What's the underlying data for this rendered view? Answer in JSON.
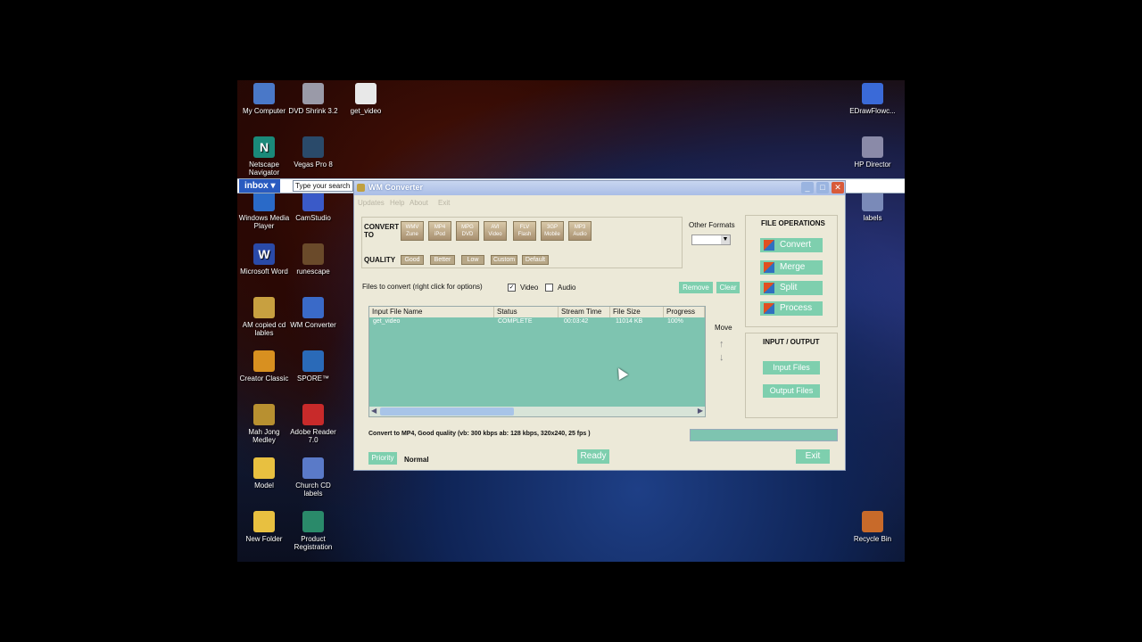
{
  "desktop": {
    "icons": [
      {
        "label": "My Computer",
        "icon": "computer-icon",
        "color": "#4a78c8"
      },
      {
        "label": "DVD Shrink 3.2",
        "icon": "dvd-icon",
        "color": "#9a9aa8"
      },
      {
        "label": "get_video",
        "icon": "file-icon",
        "color": "#e8e8e8"
      },
      {
        "label": "Netscape Navigator",
        "icon": "netscape-icon",
        "color": "#1a8a7a",
        "glyph": "N"
      },
      {
        "label": "Vegas Pro 8",
        "icon": "vegas-icon",
        "color": "#2a4a6a"
      },
      {
        "label": "Windows Media Player",
        "icon": "media-player-icon",
        "color": "#2a6ac8"
      },
      {
        "label": "CamStudio",
        "icon": "camstudio-icon",
        "color": "#3a5ac8"
      },
      {
        "label": "Microsoft Word",
        "icon": "word-icon",
        "color": "#2a4aa8",
        "glyph": "W"
      },
      {
        "label": "runescape",
        "icon": "sword-icon",
        "color": "#6a4a2a"
      },
      {
        "label": "AM copied cd lables",
        "icon": "document-icon",
        "color": "#c8a040"
      },
      {
        "label": "WM Converter",
        "icon": "converter-icon",
        "color": "#3a6ac8"
      },
      {
        "label": "Creator Classic",
        "icon": "creator-icon",
        "color": "#d89020"
      },
      {
        "label": "SPORE™",
        "icon": "spore-icon",
        "color": "#2a6ab8"
      },
      {
        "label": "Mah Jong Medley",
        "icon": "mahjong-icon",
        "color": "#b89030"
      },
      {
        "label": "Adobe Reader 7.0",
        "icon": "pdf-icon",
        "color": "#c82a2a"
      },
      {
        "label": "Model",
        "icon": "folder-icon",
        "color": "#e8c040"
      },
      {
        "label": "Church CD labels",
        "icon": "word-doc-icon",
        "color": "#5a7ac8"
      },
      {
        "label": "New Folder",
        "icon": "folder-icon",
        "color": "#e8c040"
      },
      {
        "label": "Product Registration",
        "icon": "registration-icon",
        "color": "#2a8a6a"
      },
      {
        "label": "EDrawFlowc...",
        "icon": "edraw-icon",
        "color": "#3a6ad8"
      },
      {
        "label": "HP Director",
        "icon": "hp-director-icon",
        "color": "#8a8aa8"
      },
      {
        "label": "labels",
        "icon": "labels-icon",
        "color": "#7a8ab8"
      },
      {
        "label": "Recycle Bin",
        "icon": "recycle-bin-icon",
        "color": "#c86a2a"
      }
    ],
    "inbox_label": "inbox",
    "search_text": "Type your search"
  },
  "window": {
    "title": "WM Converter",
    "menu": [
      "Updates",
      "Help",
      "About",
      "Exit"
    ],
    "convert_label": "CONVERT TO",
    "formats": [
      {
        "line1": "WMV",
        "line2": "Zune"
      },
      {
        "line1": "MP4",
        "line2": "iPod"
      },
      {
        "line1": "MPG",
        "line2": "DVD"
      },
      {
        "line1": "AVI",
        "line2": "Video"
      },
      {
        "line1": "FLV",
        "line2": "Flash"
      },
      {
        "line1": "3GP",
        "line2": "Mobile"
      },
      {
        "line1": "MP3",
        "line2": "Audio"
      }
    ],
    "quality_label": "QUALITY",
    "quality_options": [
      "Good",
      "Better",
      "Low",
      "Custom",
      "Default"
    ],
    "other_formats": "Other Formats",
    "file_operations": "FILE OPERATIONS",
    "ops": [
      "Convert",
      "Merge",
      "Split",
      "Process"
    ],
    "io_title": "INPUT / OUTPUT",
    "input_files": "Input Files",
    "output_files": "Output Files",
    "files_hint": "Files to convert (right click for options)",
    "video_label": "Video",
    "audio_label": "Audio",
    "remove": "Remove",
    "clear": "Clear",
    "move": "Move",
    "columns": [
      "Input File Name",
      "Status",
      "Stream Time",
      "File Size",
      "Progress"
    ],
    "rows": [
      {
        "name": "get_video",
        "status": "COMPLETE",
        "time": "00:03:42",
        "size": "11014 KB",
        "progress": "100%"
      }
    ],
    "convert_info": "Convert to MP4, Good quality (vb: 300 kbps ab: 128 kbps, 320x240, 25 fps )",
    "priority": "Priority",
    "priority_value": "Normal",
    "ready": "Ready",
    "exit": "Exit"
  },
  "colors": {
    "accent": "#7ecfae",
    "list_bg": "#7ec4b0",
    "window_bg": "#ece9d8",
    "titlebar": "#a9bde6"
  }
}
